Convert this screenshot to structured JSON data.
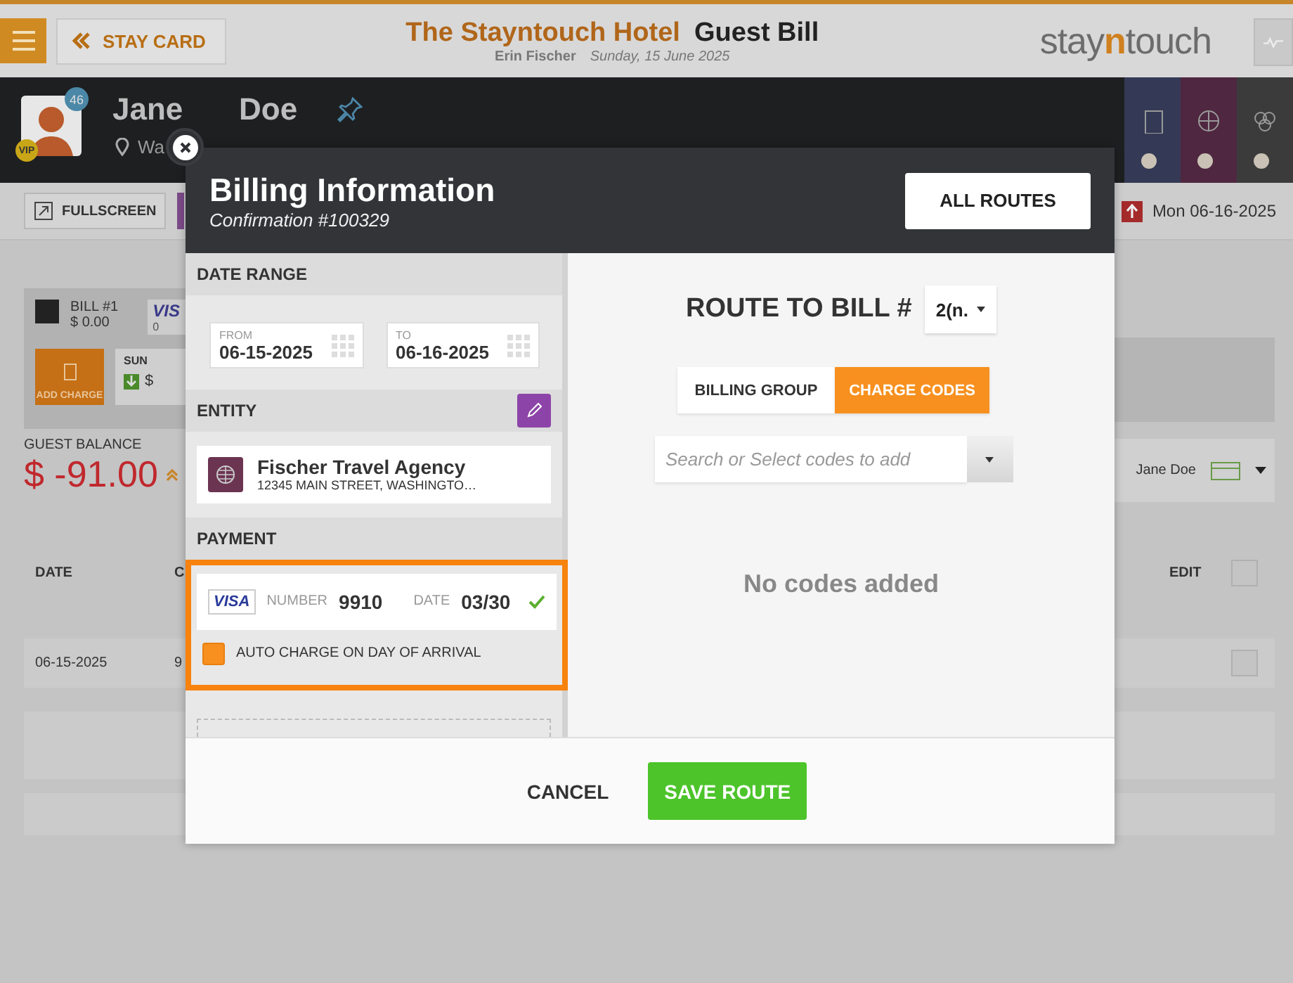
{
  "header": {
    "stay_card": "STAY CARD",
    "hotel": "The Stayntouch Hotel",
    "title": "Guest Bill",
    "user": "Erin Fischer",
    "date": "Sunday, 15 June 2025",
    "logo": [
      "stay",
      "n",
      "touch"
    ]
  },
  "guest": {
    "first_name": "Jane",
    "last_name": "Doe",
    "badge": "46",
    "vip": "VIP",
    "location": "Wa"
  },
  "toolbar": {
    "fullscreen": "FULLSCREEN",
    "departure": "Mon 06-16-2025"
  },
  "bill_card": {
    "bill": "BILL #1",
    "amount": "$ 0.00",
    "card": "VIS",
    "card_number": "0",
    "add_charge": "ADD CHARGE",
    "day": "SUN",
    "day_amount": "$"
  },
  "balance": {
    "label": "GUEST BALANCE",
    "amount": "$ -91.00"
  },
  "payer": {
    "name": "Jane Doe"
  },
  "table": {
    "columns": [
      "DATE",
      "C",
      "EDIT"
    ],
    "header_checked": false,
    "rows": [
      {
        "date": "06-15-2025",
        "column_2": "9",
        "checked": false
      }
    ]
  },
  "modal": {
    "title": "Billing Information",
    "subtitle": "Confirmation #100329",
    "all_routes": "ALL ROUTES",
    "date_range": {
      "label": "DATE RANGE",
      "from": {
        "label": "FROM",
        "value": "06-15-2025"
      },
      "to": {
        "label": "TO",
        "value": "06-16-2025"
      }
    },
    "entity": {
      "label": "ENTITY",
      "name": "Fischer Travel Agency",
      "address": "12345 MAIN STREET, WASHINGTO…"
    },
    "payment": {
      "label": "PAYMENT",
      "highlighted": true,
      "brand": "VISA",
      "number_label": "NUMBER",
      "number": "9910",
      "date_label": "DATE",
      "date": "03/30",
      "valid": true,
      "auto_charge": {
        "label": "AUTO CHARGE ON DAY OF ARRIVAL",
        "checked": true
      }
    },
    "route": {
      "label": "ROUTE TO BILL #",
      "bill": "2(n.",
      "tabs": [
        {
          "label": "BILLING GROUP",
          "selected": false
        },
        {
          "label": "CHARGE CODES",
          "selected": true
        }
      ],
      "search": {
        "placeholder": "Search or Select codes to add"
      },
      "empty": "No codes added"
    },
    "cancel": "CANCEL",
    "save": "SAVE ROUTE"
  }
}
